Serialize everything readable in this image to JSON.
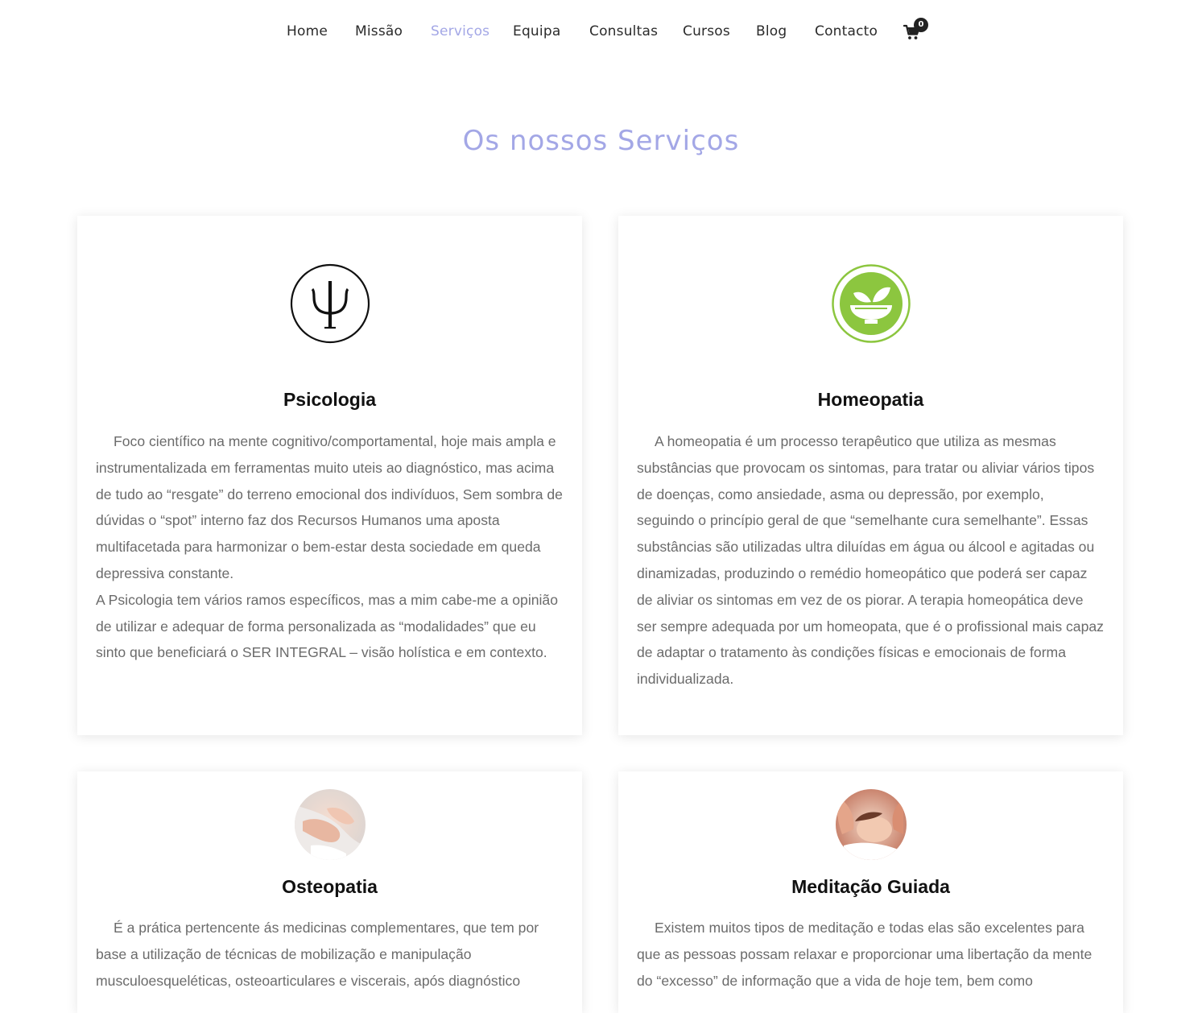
{
  "nav": {
    "items": [
      {
        "label": "Home",
        "active": false
      },
      {
        "label": "Missão",
        "active": false
      },
      {
        "label": "Serviços",
        "active": true
      },
      {
        "label": "Equipa",
        "active": false
      },
      {
        "label": "Consultas",
        "active": false
      },
      {
        "label": "Cursos",
        "active": false
      },
      {
        "label": "Blog",
        "active": false
      },
      {
        "label": "Contacto",
        "active": false
      }
    ],
    "cart_count": "0",
    "cart_icon": "shopping-cart-icon"
  },
  "page": {
    "title": "Os nossos Serviços",
    "accent_color": "#a3a7e6"
  },
  "services": [
    {
      "title": "Psicologia",
      "icon": "psi-symbol-icon",
      "paragraphs": [
        "Foco científico na mente cognitivo/comportamental, hoje mais ampla e instrumentalizada em ferramentas muito uteis ao diagnóstico, mas acima de tudo ao “resgate” do terreno emocional dos indivíduos, Sem sombra de dúvidas o “spot” interno faz dos Recursos Humanos uma aposta multifacetada para harmonizar o bem-estar desta sociedade em queda depressiva constante.",
        "A Psicologia tem vários ramos específicos, mas a mim cabe-me a opinião de utilizar e adequar de forma personalizada as “modalidades” que eu sinto que beneficiará o SER INTEGRAL – visão holística e em contexto."
      ]
    },
    {
      "title": "Homeopatia",
      "icon": "herbal-bowl-icon",
      "paragraphs": [
        "A homeopatia é um processo terapêutico que utiliza as mesmas substâncias que provocam os sintomas, para tratar ou aliviar vários tipos de doenças, como ansiedade, asma ou depressão, por exemplo, seguindo o princípio geral de que “semelhante cura semelhante”. Essas substâncias são utilizadas ultra diluídas em água ou álcool e agitadas ou dinamizadas, produzindo o remédio homeopático que poderá ser capaz de aliviar os sintomas em vez de os piorar. A terapia homeopática deve ser sempre adequada por um homeopata, que é o profissional mais capaz de adaptar o tratamento às condições físicas e emocionais de forma individualizada."
      ]
    },
    {
      "title": "Osteopatia",
      "icon": "osteopathy-photo",
      "paragraphs": [
        "É a prática pertencente ás medicinas complementares, que tem por base a utilização de técnicas de mobilização e manipulação musculoesqueléticas, osteoarticulares e viscerais, após diagnóstico"
      ]
    },
    {
      "title": "Meditação Guiada",
      "icon": "meditation-photo",
      "paragraphs": [
        "Existem muitos tipos de meditação e todas elas são excelentes para que as pessoas possam relaxar e proporcionar uma libertação da mente do “excesso” de informação que a vida de hoje tem, bem como"
      ]
    }
  ]
}
